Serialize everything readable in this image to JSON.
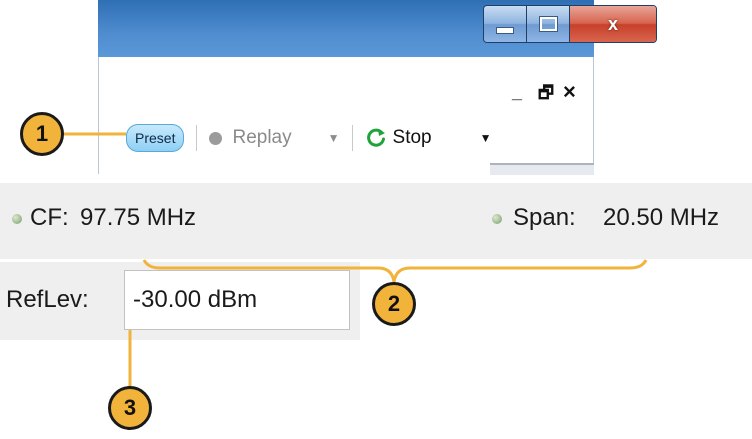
{
  "window": {
    "minimize_label": "",
    "maximize_label": "",
    "close_label": "x"
  },
  "panel": {
    "minimize_label": "_",
    "restore_label": "🗗",
    "close_label": "×"
  },
  "toolbar": {
    "preset_label": "Preset",
    "replay_label": "Replay",
    "stop_label": "Stop"
  },
  "measure": {
    "cf_label": "CF:",
    "cf_value": "97.75 MHz",
    "span_label": "Span:",
    "span_value": "20.50 MHz",
    "reflev_label": "RefLev:",
    "reflev_value": "-30.00 dBm"
  },
  "callouts": [
    "1",
    "2",
    "3"
  ],
  "colors": {
    "callout_fill": "#f2b33b",
    "callout_line": "#f2b33b",
    "preset_accent": "#8fd0f5",
    "stop_icon": "#1fa33a"
  }
}
